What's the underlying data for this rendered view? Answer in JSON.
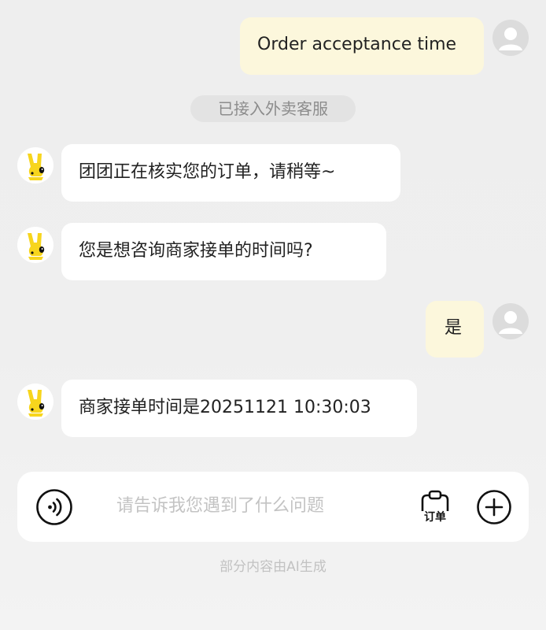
{
  "messages": [
    {
      "role": "user",
      "text": "Order acceptance time"
    },
    {
      "role": "system",
      "text": "已接入外卖客服"
    },
    {
      "role": "bot",
      "text": "团团正在核实您的订单，请稍等~"
    },
    {
      "role": "bot",
      "text": "您是想咨询商家接单的时间吗?"
    },
    {
      "role": "user",
      "text": "是"
    },
    {
      "role": "bot",
      "text": "商家接单时间是20251121 10:30:03"
    }
  ],
  "input": {
    "placeholder": "请告诉我您遇到了什么问题",
    "value": "",
    "order_label": "订单"
  },
  "footer": {
    "note": "部分内容由AI生成"
  },
  "icons": {
    "user_avatar": "default-user-avatar-icon",
    "bot_avatar": "yellow-kangaroo-mascot-icon",
    "voice": "voice-input-icon",
    "order": "clipboard-order-icon",
    "more": "plus-circle-icon"
  },
  "colors": {
    "user_bubble": "#fcf7dc",
    "bot_bubble": "#ffffff",
    "background": "#efefef",
    "mascot_yellow": "#f7d51d",
    "system_pill": "#e3e3e3"
  }
}
